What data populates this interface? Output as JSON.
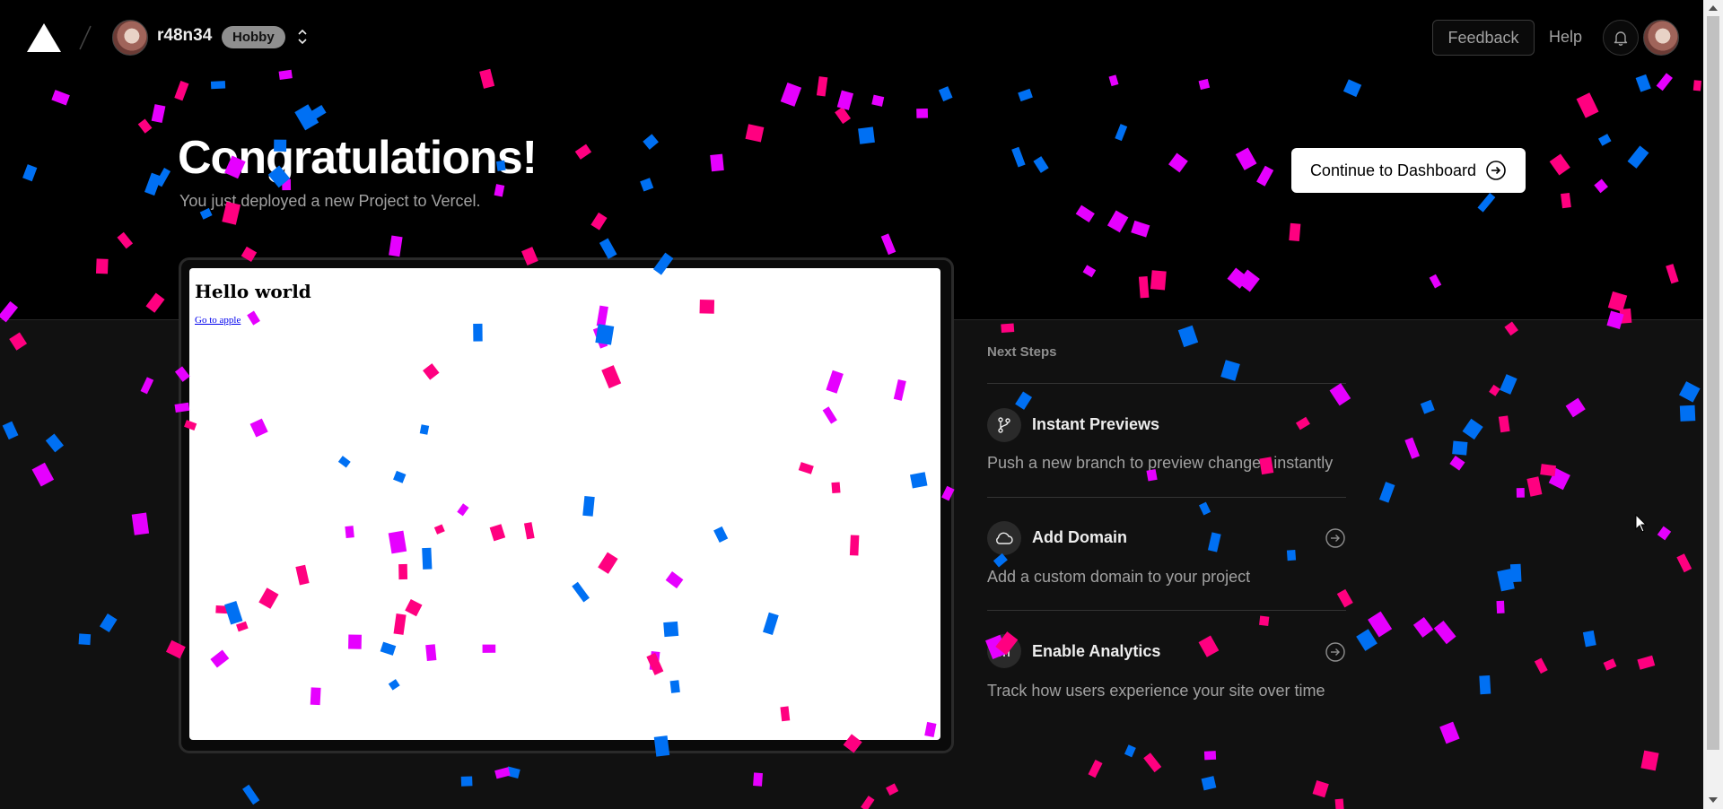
{
  "colors": {
    "pink": "#ff0080",
    "blue": "#0070f3",
    "magenta": "#e600ff"
  },
  "header": {
    "team_name": "r48n34",
    "plan_badge": "Hobby",
    "feedback_label": "Feedback",
    "help_label": "Help"
  },
  "hero": {
    "title": "Congratulations!",
    "subtitle": "You just deployed a new Project to Vercel.",
    "continue_label": "Continue to Dashboard"
  },
  "preview": {
    "heading": "Hello world",
    "link": "Go to apple"
  },
  "next_steps": {
    "title": "Next Steps",
    "items": [
      {
        "icon": "git-branch-icon",
        "title": "Instant Previews",
        "description": "Push a new branch to preview changes instantly"
      },
      {
        "icon": "cloud-icon",
        "title": "Add Domain",
        "description": "Add a custom domain to your project"
      },
      {
        "icon": "bar-chart-icon",
        "title": "Enable Analytics",
        "description": "Track how users experience your site over time"
      }
    ]
  }
}
